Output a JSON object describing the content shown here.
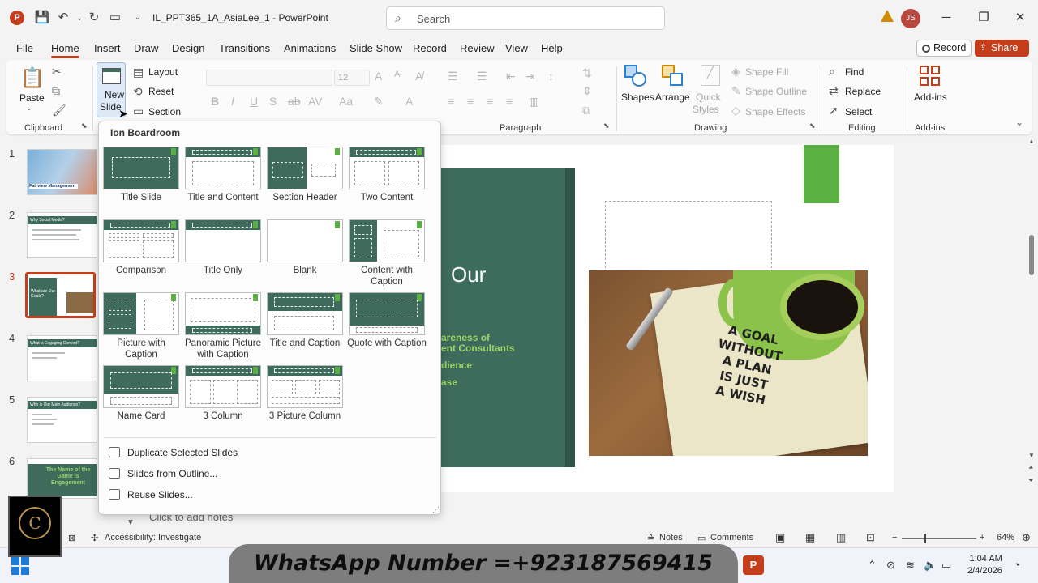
{
  "titlebar": {
    "doc_title": "IL_PPT365_1A_AsiaLee_1  -  PowerPoint",
    "search_placeholder": "Search",
    "user_initials": "JS",
    "app_icon_letter": "P"
  },
  "menu": {
    "tabs": [
      "File",
      "Home",
      "Insert",
      "Draw",
      "Design",
      "Transitions",
      "Animations",
      "Slide Show",
      "Record",
      "Review",
      "View",
      "Help"
    ],
    "record_label": "Record",
    "share_label": "Share"
  },
  "ribbon": {
    "clipboard": {
      "paste": "Paste",
      "group": "Clipboard"
    },
    "slides": {
      "new_slide_1": "New",
      "new_slide_2": "Slide",
      "layout": "Layout",
      "reset": "Reset",
      "section": "Section"
    },
    "font": {
      "size": "12"
    },
    "paragraph": {
      "group": "Paragraph"
    },
    "drawing": {
      "shapes": "Shapes",
      "arrange": "Arrange",
      "quick_styles_1": "Quick",
      "quick_styles_2": "Styles",
      "shape_fill": "Shape Fill",
      "shape_outline": "Shape Outline",
      "shape_effects": "Shape Effects",
      "group": "Drawing"
    },
    "editing": {
      "find": "Find",
      "replace": "Replace",
      "select": "Select",
      "group": "Editing"
    },
    "addins": {
      "label": "Add-ins",
      "group": "Add-ins"
    }
  },
  "thumbnails": [
    {
      "num": "1",
      "caption": "Fairview Management"
    },
    {
      "num": "2",
      "caption": "Why Social Media?"
    },
    {
      "num": "3",
      "caption": "What are Our Goals?"
    },
    {
      "num": "4",
      "caption": "What is Engaging Content?"
    },
    {
      "num": "5",
      "caption": "Who is Our Main Audience?"
    },
    {
      "num": "6",
      "caption": "The Name of the Game is Engagement"
    }
  ],
  "slide": {
    "title_fragment": "Our",
    "bullets": [
      "areness of",
      "ent Consultants",
      "dience",
      "ase"
    ],
    "photo_text": "A GOAL\nWITHOUT\nA PLAN\nIS JUST\nA WISH"
  },
  "notes_placeholder": "Click to add notes",
  "gallery": {
    "title": "Ion Boardroom",
    "layouts": [
      "Title Slide",
      "Title and Content",
      "Section Header",
      "Two Content",
      "Comparison",
      "Title Only",
      "Blank",
      "Content with Caption",
      "Picture with Caption",
      "Panoramic Picture with Caption",
      "Title and Caption",
      "Quote with Caption",
      "Name Card",
      "3 Column",
      "3 Picture Column"
    ],
    "commands": [
      "Duplicate Selected Slides",
      "Slides from Outline...",
      "Reuse Slides..."
    ]
  },
  "statusbar": {
    "accessibility": "Accessibility: Investigate",
    "notes": "Notes",
    "comments": "Comments",
    "zoom": "64%"
  },
  "taskbar": {
    "banner": "WhatsApp Number =+923187569415",
    "time": "1:04 AM",
    "date": "2/4/2026"
  },
  "colors": {
    "accent": "#c43e1c",
    "slide_green": "#3d6b5c",
    "bright_green": "#5bb043"
  }
}
